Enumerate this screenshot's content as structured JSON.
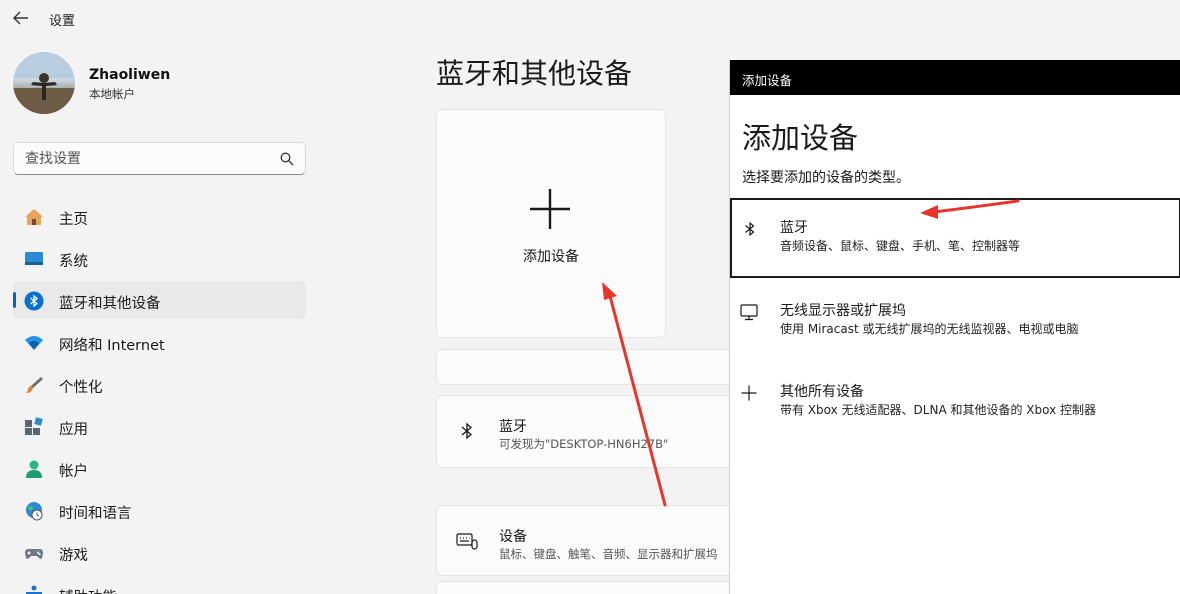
{
  "window": {
    "title": "设置",
    "back_icon": "back-arrow-icon"
  },
  "profile": {
    "name": "Zhaoliwen",
    "account_type": "本地帐户"
  },
  "search": {
    "placeholder": "查找设置",
    "icon": "search-icon"
  },
  "sidebar": {
    "items": [
      {
        "label": "主页",
        "icon": "home-icon",
        "active": false
      },
      {
        "label": "系统",
        "icon": "display-icon",
        "active": false
      },
      {
        "label": "蓝牙和其他设备",
        "icon": "bluetooth-icon",
        "active": true
      },
      {
        "label": "网络和 Internet",
        "icon": "wifi-icon",
        "active": false
      },
      {
        "label": "个性化",
        "icon": "brush-icon",
        "active": false
      },
      {
        "label": "应用",
        "icon": "apps-icon",
        "active": false
      },
      {
        "label": "帐户",
        "icon": "person-icon",
        "active": false
      },
      {
        "label": "时间和语言",
        "icon": "globe-clock-icon",
        "active": false
      },
      {
        "label": "游戏",
        "icon": "gamepad-icon",
        "active": false
      },
      {
        "label": "辅助功能",
        "icon": "accessibility-icon",
        "active": false
      }
    ]
  },
  "main": {
    "title": "蓝牙和其他设备",
    "add_device_tile": {
      "label": "添加设备"
    },
    "bluetooth_card": {
      "title": "蓝牙",
      "subtitle": "可发现为\"DESKTOP-HN6H27B\""
    },
    "devices_card": {
      "title": "设备",
      "subtitle": "鼠标、键盘、触笔、音频、显示器和扩展坞"
    }
  },
  "dialog": {
    "bar_title": "添加设备",
    "heading": "添加设备",
    "subtitle": "选择要添加的设备的类型。",
    "options": [
      {
        "title": "蓝牙",
        "subtitle": "音频设备、鼠标、键盘、手机、笔、控制器等",
        "icon": "bluetooth-icon",
        "selected": true
      },
      {
        "title": "无线显示器或扩展坞",
        "subtitle": "使用 Miracast 或无线扩展坞的无线监视器、电视或电脑",
        "icon": "monitor-icon",
        "selected": false
      },
      {
        "title": "其他所有设备",
        "subtitle": "带有 Xbox 无线适配器、DLNA 和其他设备的 Xbox 控制器",
        "icon": "plus-icon",
        "selected": false
      }
    ]
  },
  "colors": {
    "accent": "#0067c0",
    "annotation_arrow": "#e8352b",
    "dialog_bar": "#000000",
    "background": "#f3f3f3"
  }
}
